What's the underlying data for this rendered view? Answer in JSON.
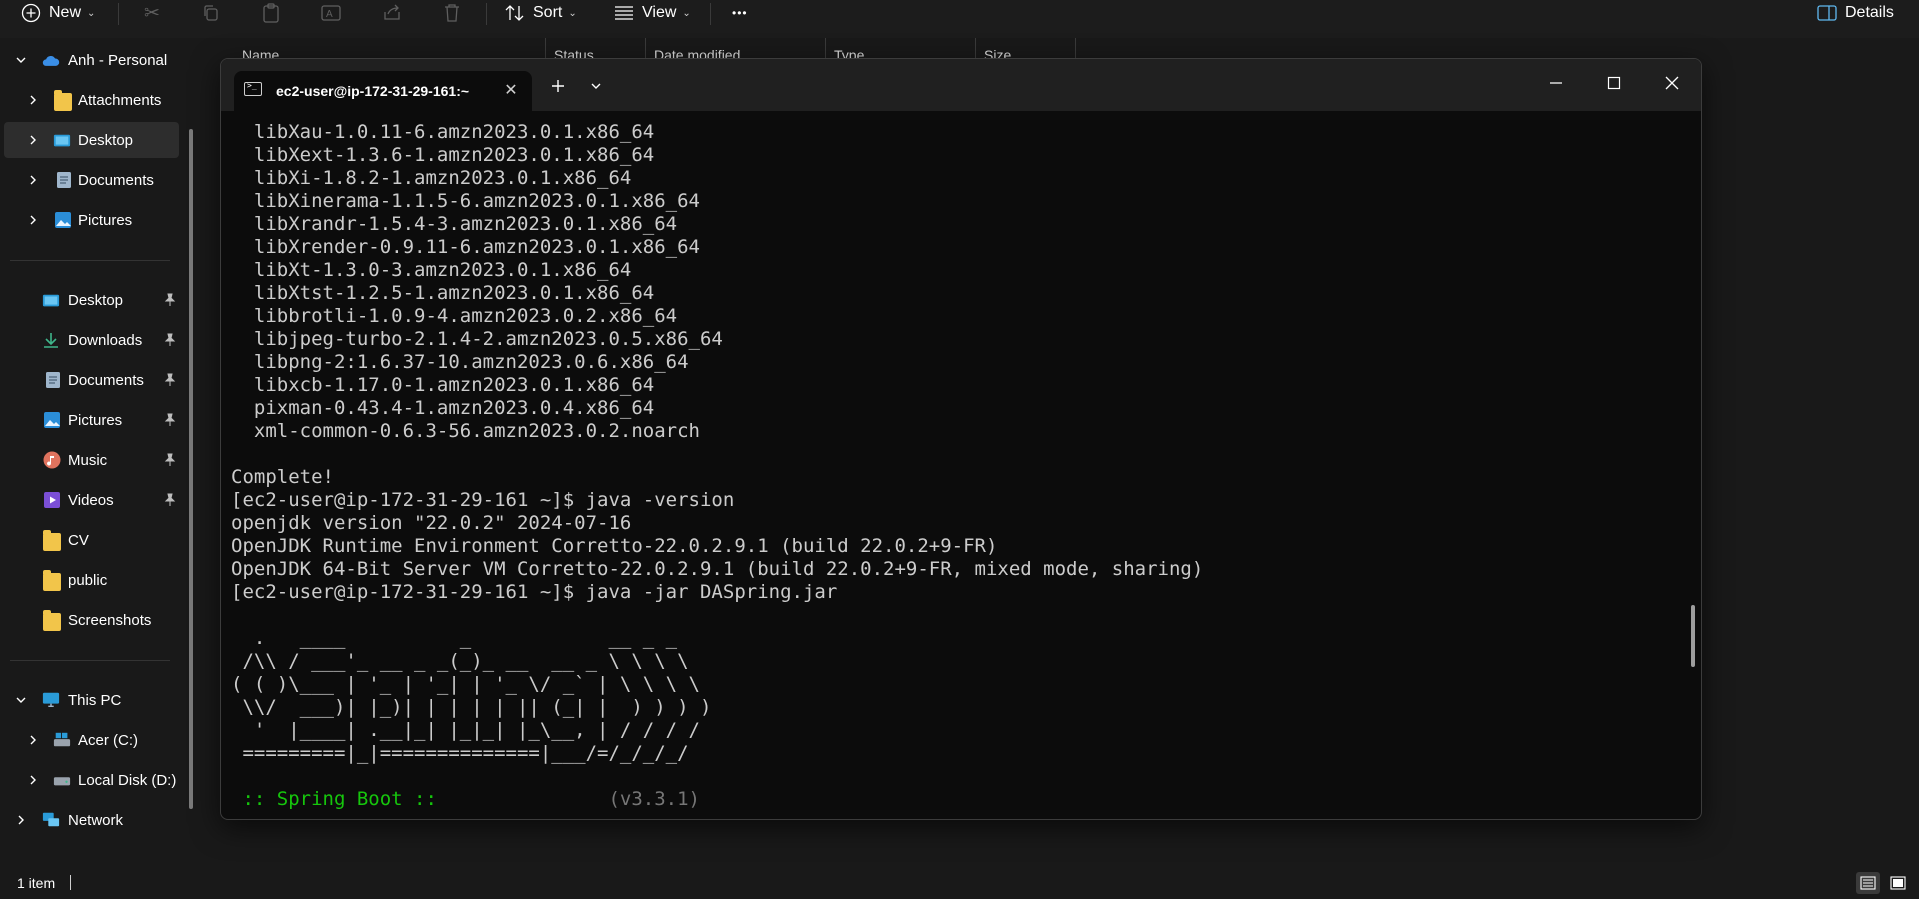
{
  "toolbar": {
    "new_label": "New",
    "sort_label": "Sort",
    "view_label": "View",
    "more_label": "•••",
    "details_label": "Details"
  },
  "columns": [
    "Name",
    "Status",
    "Date modified",
    "Type",
    "Size"
  ],
  "sidebar": {
    "onedrive": {
      "label": "Anh - Personal",
      "children": [
        "Attachments",
        "Desktop",
        "Documents",
        "Pictures"
      ]
    },
    "quick_access": [
      "Desktop",
      "Downloads",
      "Documents",
      "Pictures",
      "Music",
      "Videos",
      "CV",
      "public",
      "Screenshots"
    ],
    "this_pc": {
      "label": "This PC",
      "children": [
        "Acer (C:)",
        "Local Disk (D:)"
      ]
    },
    "network": "Network"
  },
  "terminal": {
    "tab_title": "ec2-user@ip-172-31-29-161:~",
    "lines": [
      "  libXau-1.0.11-6.amzn2023.0.1.x86_64",
      "  libXext-1.3.6-1.amzn2023.0.1.x86_64",
      "  libXi-1.8.2-1.amzn2023.0.1.x86_64",
      "  libXinerama-1.1.5-6.amzn2023.0.1.x86_64",
      "  libXrandr-1.5.4-3.amzn2023.0.1.x86_64",
      "  libXrender-0.9.11-6.amzn2023.0.1.x86_64",
      "  libXt-1.3.0-3.amzn2023.0.1.x86_64",
      "  libXtst-1.2.5-1.amzn2023.0.1.x86_64",
      "  libbrotli-1.0.9-4.amzn2023.0.2.x86_64",
      "  libjpeg-turbo-2.1.4-2.amzn2023.0.5.x86_64",
      "  libpng-2:1.6.37-10.amzn2023.0.6.x86_64",
      "  libxcb-1.17.0-1.amzn2023.0.1.x86_64",
      "  pixman-0.43.4-1.amzn2023.0.4.x86_64",
      "  xml-common-0.6.3-56.amzn2023.0.2.noarch",
      "",
      "Complete!",
      "[ec2-user@ip-172-31-29-161 ~]$ java -version",
      "openjdk version \"22.0.2\" 2024-07-16",
      "OpenJDK Runtime Environment Corretto-22.0.2.9.1 (build 22.0.2+9-FR)",
      "OpenJDK 64-Bit Server VM Corretto-22.0.2.9.1 (build 22.0.2+9-FR, mixed mode, sharing)",
      "[ec2-user@ip-172-31-29-161 ~]$ java -jar DASpring.jar",
      "",
      "  .   ____          _            __ _ _",
      " /\\\\ / ___'_ __ _ _(_)_ __  __ _ \\ \\ \\ \\",
      "( ( )\\___ | '_ | '_| | '_ \\/ _` | \\ \\ \\ \\",
      " \\\\/  ___)| |_)| | | | | || (_| |  ) ) ) )",
      "  '  |____| .__|_| |_|_| |_\\__, | / / / /",
      " =========|_|==============|___/=/_/_/_/",
      ""
    ],
    "spring_boot_label": " :: Spring Boot :: ",
    "spring_boot_version": "              (v3.3.1)"
  },
  "status": {
    "item_count": "1 item"
  }
}
